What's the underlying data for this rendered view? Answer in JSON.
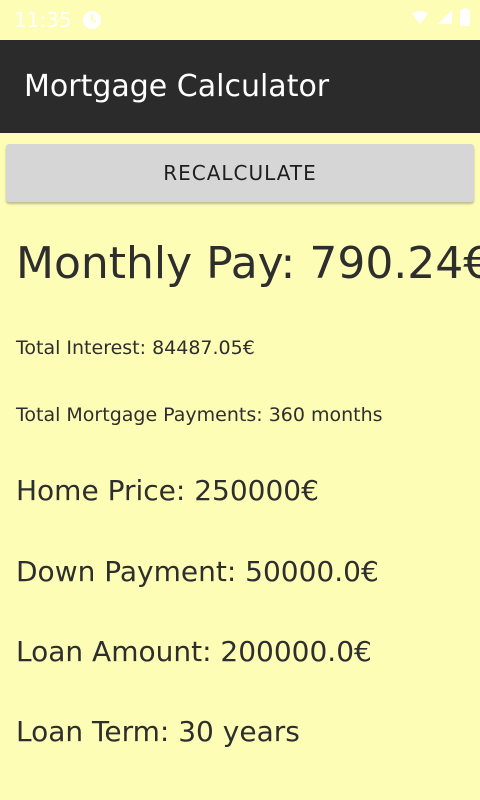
{
  "status_bar": {
    "time": "11:35"
  },
  "app_bar": {
    "title": "Mortgage Calculator"
  },
  "actions": {
    "recalculate_label": "RECALCULATE"
  },
  "results": {
    "monthly_pay": "Monthly Pay: 790.24€",
    "total_interest": "Total Interest: 84487.05€",
    "total_payments": "Total Mortgage Payments: 360 months",
    "home_price": "Home Price: 250000€",
    "down_payment": "Down Payment: 50000.0€",
    "loan_amount": "Loan Amount: 200000.0€",
    "loan_term": "Loan Term: 30 years"
  },
  "colors": {
    "background": "#fdfdb6",
    "app_bar": "#2b2b2b",
    "button": "#d6d6d6",
    "text": "#2e2e2e"
  },
  "icons": {
    "status_left": "notification-circle-icon",
    "wifi": "wifi-icon",
    "signal": "signal-icon",
    "battery": "battery-icon"
  }
}
